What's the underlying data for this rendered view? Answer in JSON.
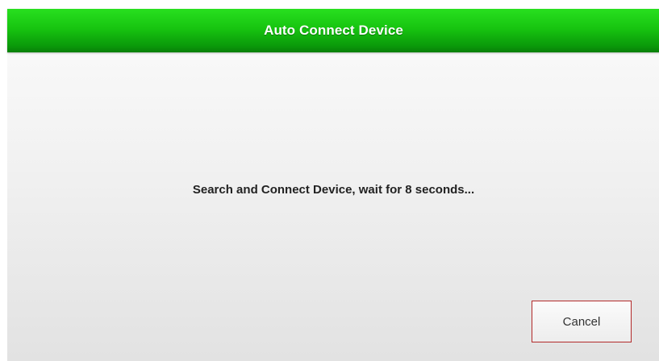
{
  "dialog": {
    "title": "Auto Connect Device",
    "message": "Search and Connect Device, wait for 8 seconds...",
    "cancel_label": "Cancel"
  },
  "colors": {
    "title_bar": "#17c410",
    "title_text": "#ffffff",
    "cancel_border": "#b22a2a"
  }
}
